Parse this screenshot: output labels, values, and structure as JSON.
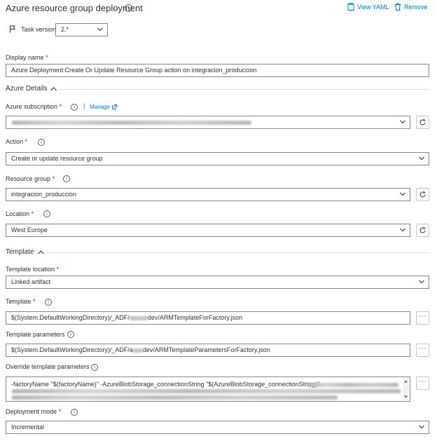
{
  "header": {
    "title": "Azure resource group deployment",
    "view_yaml": "View YAML",
    "remove": "Remove"
  },
  "task_version": {
    "label": "Task version",
    "value": "2.*"
  },
  "display_name": {
    "label": "Display name",
    "value": "Azure Deployment:Create Or Update Resource Group action on integracion_produccion"
  },
  "azure_details": {
    "heading": "Azure Details",
    "subscription": {
      "label": "Azure subscription",
      "manage": "Manage"
    },
    "action": {
      "label": "Action",
      "value": "Create or update resource group"
    },
    "resource_group": {
      "label": "Resource group",
      "value": "integracion_produccion"
    },
    "location": {
      "label": "Location",
      "value": "West Europe"
    }
  },
  "template": {
    "heading": "Template",
    "template_location": {
      "label": "Template location",
      "value": "Linked artifact"
    },
    "template_path": {
      "label": "Template",
      "prefix": "$(System.DefaultWorkingDirectory)/_ADF/",
      "suffix": "dev/ARMTemplateForFactory.json"
    },
    "template_parameters": {
      "label": "Template parameters",
      "prefix": "$(System.DefaultWorkingDirectory)/_ADF/a",
      "suffix": "dev/ARMTemplateParametersForFactory.json"
    },
    "override": {
      "label": "Override template parameters",
      "value": "-factoryName \"$(factoryName)\" -AzureBlobStorage_connectionString \"$(AzureBlobStorage_connectionString)\" -"
    },
    "deployment_mode": {
      "label": "Deployment mode",
      "value": "Incremental"
    }
  },
  "required_marker": "*",
  "info_glyph": "i",
  "more_glyph": "···"
}
